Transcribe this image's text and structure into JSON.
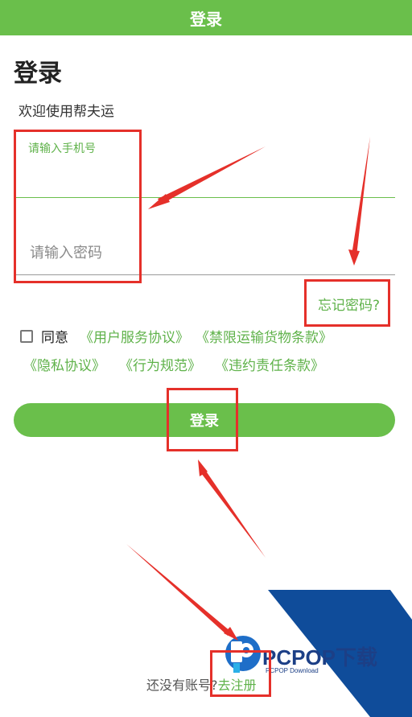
{
  "header": {
    "title": "登录"
  },
  "page": {
    "title": "登录",
    "welcome": "欢迎使用帮夫运"
  },
  "form": {
    "phone_label": "请输入手机号",
    "phone_value": "",
    "password_placeholder": "请输入密码",
    "password_value": "",
    "forgot_label": "忘记密码?"
  },
  "agreement": {
    "checked": false,
    "prefix": "同意",
    "links": [
      "《用户服务协议》",
      "《禁限运输货物条款》",
      "《隐私协议》",
      "《行为规范》",
      "《违约责任条款》"
    ]
  },
  "login_button": "登录",
  "register": {
    "prompt": "还没有账号?",
    "link": "去注册"
  },
  "watermark": {
    "brand": "PCPOP下载",
    "sub": "PCPOP Download"
  },
  "colors": {
    "primary": "#6abf4b",
    "annotation": "#e5302a",
    "watermark_blue": "#0f4c9a"
  }
}
